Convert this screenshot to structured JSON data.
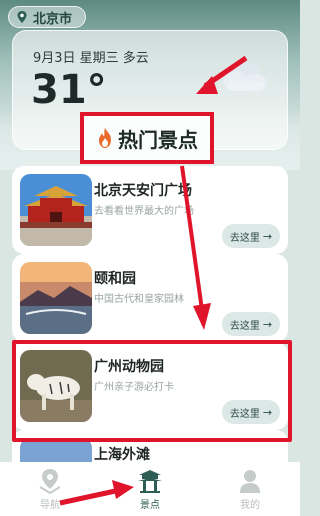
{
  "location": {
    "city": "北京市",
    "icon": "pin-icon"
  },
  "weather": {
    "date_line": "9月3日 星期三 多云",
    "temperature": "31°",
    "icon": "cloud-icon"
  },
  "section": {
    "title": "热门景点",
    "icon": "fire-icon"
  },
  "attractions": [
    {
      "title": "北京天安门广场",
      "subtitle": "去看看世界最大的广场",
      "button": "去这里",
      "button_icon": "arrow-right-icon"
    },
    {
      "title": "颐和园",
      "subtitle": "中国古代和皇家园林",
      "button": "去这里",
      "button_icon": "arrow-right-icon"
    },
    {
      "title": "广州动物园",
      "subtitle": "广州亲子游必打卡",
      "button": "去这里",
      "button_icon": "arrow-right-icon"
    },
    {
      "title": "上海外滩",
      "subtitle": "",
      "button": "",
      "button_icon": ""
    }
  ],
  "nav": {
    "items": [
      {
        "label": "导航",
        "icon": "navigation-icon",
        "active": false
      },
      {
        "label": "景点",
        "icon": "pagoda-icon",
        "active": true
      },
      {
        "label": "我的",
        "icon": "user-icon",
        "active": false
      }
    ]
  },
  "colors": {
    "accent": "#2d5d54",
    "highlight": "#e0142a",
    "card": "#ffffff",
    "button_bg": "#dbe8e5"
  }
}
